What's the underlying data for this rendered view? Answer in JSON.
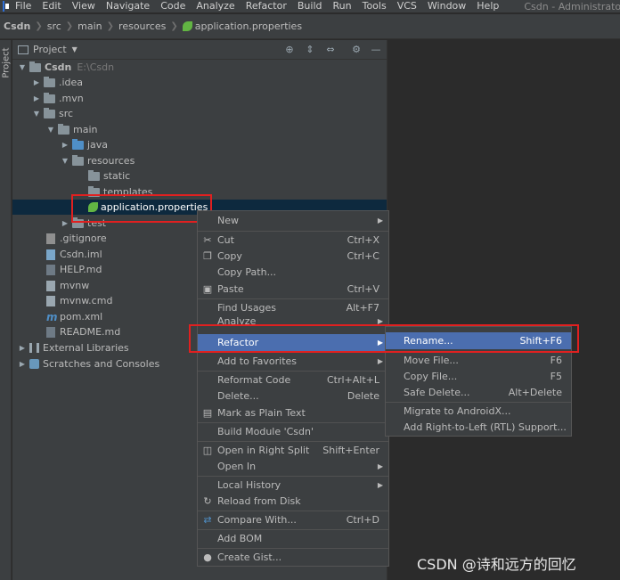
{
  "menubar": {
    "items": [
      "File",
      "Edit",
      "View",
      "Navigate",
      "Code",
      "Analyze",
      "Refactor",
      "Build",
      "Run",
      "Tools",
      "VCS",
      "Window",
      "Help"
    ],
    "window_title": "Csdn - Administrator"
  },
  "breadcrumb": [
    "Csdn",
    "src",
    "main",
    "resources",
    "application.properties"
  ],
  "stripe_label": "Project",
  "panel": {
    "title": "Project",
    "tree": [
      {
        "label": "Csdn",
        "hint": "E:\\Csdn",
        "icon": "folder",
        "arrow": "down"
      },
      {
        "label": ".idea",
        "icon": "folder",
        "arrow": "right"
      },
      {
        "label": ".mvn",
        "icon": "folder",
        "arrow": "right"
      },
      {
        "label": "src",
        "icon": "folder",
        "arrow": "down"
      },
      {
        "label": "main",
        "icon": "folder",
        "arrow": "down"
      },
      {
        "label": "java",
        "icon": "folder-blue",
        "arrow": "right"
      },
      {
        "label": "resources",
        "icon": "folder",
        "arrow": "down"
      },
      {
        "label": "static",
        "icon": "folder"
      },
      {
        "label": "templates",
        "icon": "folder"
      },
      {
        "label": "application.properties",
        "icon": "spring-leaf",
        "selected": true
      },
      {
        "label": "test",
        "icon": "folder",
        "arrow": "right"
      },
      {
        "label": ".gitignore",
        "icon": "git-file"
      },
      {
        "label": "Csdn.iml",
        "icon": "iml-file"
      },
      {
        "label": "HELP.md",
        "icon": "md-file"
      },
      {
        "label": "mvnw",
        "icon": "file"
      },
      {
        "label": "mvnw.cmd",
        "icon": "file"
      },
      {
        "label": "pom.xml",
        "icon": "maven"
      },
      {
        "label": "README.md",
        "icon": "md-file"
      },
      {
        "label": "External Libraries",
        "icon": "library",
        "arrow": "right"
      },
      {
        "label": "Scratches and Consoles",
        "icon": "scratch",
        "arrow": "right"
      }
    ]
  },
  "context_menu": {
    "items": [
      {
        "label": "New",
        "submenu": true
      },
      {
        "label": "Cut",
        "shortcut": "Ctrl+X",
        "icon": "cut-icon"
      },
      {
        "label": "Copy",
        "shortcut": "Ctrl+C",
        "icon": "copy-icon"
      },
      {
        "label": "Copy Path..."
      },
      {
        "label": "Paste",
        "shortcut": "Ctrl+V",
        "icon": "paste-icon"
      },
      {
        "label": "Find Usages",
        "shortcut": "Alt+F7"
      },
      {
        "label": "Analyze",
        "submenu": true
      },
      {
        "label": "Refactor",
        "submenu": true,
        "active": true
      },
      {
        "label": "Add to Favorites",
        "submenu": true
      },
      {
        "label": "Reformat Code",
        "shortcut": "Ctrl+Alt+L"
      },
      {
        "label": "Delete...",
        "shortcut": "Delete"
      },
      {
        "label": "Mark as Plain Text",
        "icon": "plain-text-icon"
      },
      {
        "label": "Build Module 'Csdn'"
      },
      {
        "label": "Open in Right Split",
        "shortcut": "Shift+Enter",
        "icon": "split-icon"
      },
      {
        "label": "Open In",
        "submenu": true
      },
      {
        "label": "Local History",
        "submenu": true
      },
      {
        "label": "Reload from Disk",
        "icon": "reload-icon"
      },
      {
        "label": "Compare With...",
        "shortcut": "Ctrl+D",
        "icon": "compare-icon"
      },
      {
        "label": "Add BOM"
      },
      {
        "label": "Create Gist...",
        "icon": "github-icon"
      }
    ]
  },
  "refactor_submenu": {
    "items": [
      {
        "label": "Rename...",
        "shortcut": "Shift+F6",
        "active": true
      },
      {
        "label": "Move File...",
        "shortcut": "F6"
      },
      {
        "label": "Copy File...",
        "shortcut": "F5"
      },
      {
        "label": "Safe Delete...",
        "shortcut": "Alt+Delete"
      },
      {
        "label": "Migrate to AndroidX..."
      },
      {
        "label": "Add Right-to-Left (RTL) Support..."
      }
    ]
  },
  "watermark": "CSDN @诗和远方的回忆",
  "colors": {
    "panel_bg": "#3c3f41",
    "editor_bg": "#2b2b2b",
    "selection": "#0d293e",
    "menu_active": "#4b6eaf",
    "highlight_frame": "#e02020"
  }
}
